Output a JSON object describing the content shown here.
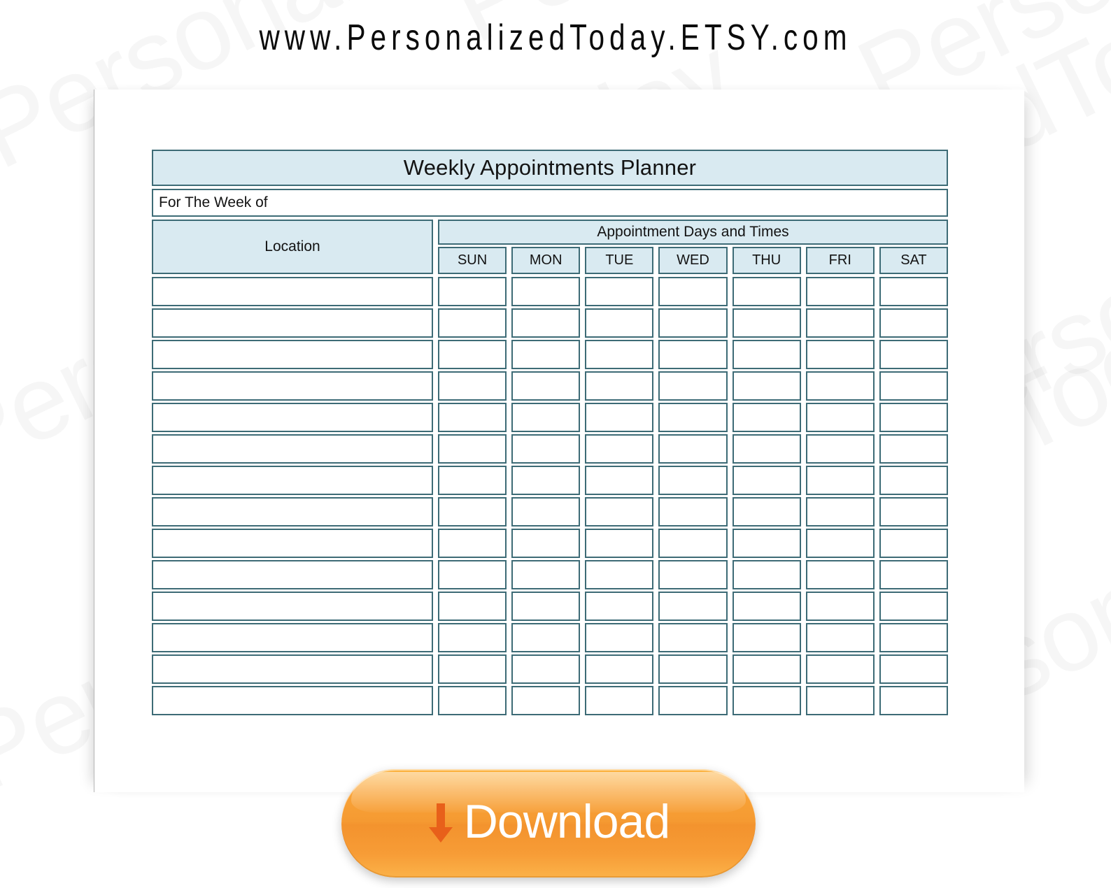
{
  "banner": {
    "url": "www.PersonalizedToday.ETSY.com"
  },
  "watermark": {
    "text": "PersonalizedToday"
  },
  "planner": {
    "title": "Weekly Appointments Planner",
    "week_of_label": "For The Week of",
    "week_of_value": "",
    "location_header": "Location",
    "days_header": "Appointment Days and Times",
    "day_columns": [
      "SUN",
      "MON",
      "TUE",
      "WED",
      "THU",
      "FRI",
      "SAT"
    ],
    "row_count": 14,
    "rows": [
      {
        "location": "",
        "days": [
          "",
          "",
          "",
          "",
          "",
          "",
          ""
        ]
      },
      {
        "location": "",
        "days": [
          "",
          "",
          "",
          "",
          "",
          "",
          ""
        ]
      },
      {
        "location": "",
        "days": [
          "",
          "",
          "",
          "",
          "",
          "",
          ""
        ]
      },
      {
        "location": "",
        "days": [
          "",
          "",
          "",
          "",
          "",
          "",
          ""
        ]
      },
      {
        "location": "",
        "days": [
          "",
          "",
          "",
          "",
          "",
          "",
          ""
        ]
      },
      {
        "location": "",
        "days": [
          "",
          "",
          "",
          "",
          "",
          "",
          ""
        ]
      },
      {
        "location": "",
        "days": [
          "",
          "",
          "",
          "",
          "",
          "",
          ""
        ]
      },
      {
        "location": "",
        "days": [
          "",
          "",
          "",
          "",
          "",
          "",
          ""
        ]
      },
      {
        "location": "",
        "days": [
          "",
          "",
          "",
          "",
          "",
          "",
          ""
        ]
      },
      {
        "location": "",
        "days": [
          "",
          "",
          "",
          "",
          "",
          "",
          ""
        ]
      },
      {
        "location": "",
        "days": [
          "",
          "",
          "",
          "",
          "",
          "",
          ""
        ]
      },
      {
        "location": "",
        "days": [
          "",
          "",
          "",
          "",
          "",
          "",
          ""
        ]
      },
      {
        "location": "",
        "days": [
          "",
          "",
          "",
          "",
          "",
          "",
          ""
        ]
      },
      {
        "location": "",
        "days": [
          "",
          "",
          "",
          "",
          "",
          "",
          ""
        ]
      }
    ]
  },
  "download": {
    "label": "Download",
    "icon": "down-arrow-icon"
  },
  "colors": {
    "header_fill": "#d9eaf1",
    "grid_border": "#3d6b76",
    "button_orange": "#f59a32",
    "button_arrow": "#e8601a",
    "text": "#131313"
  }
}
